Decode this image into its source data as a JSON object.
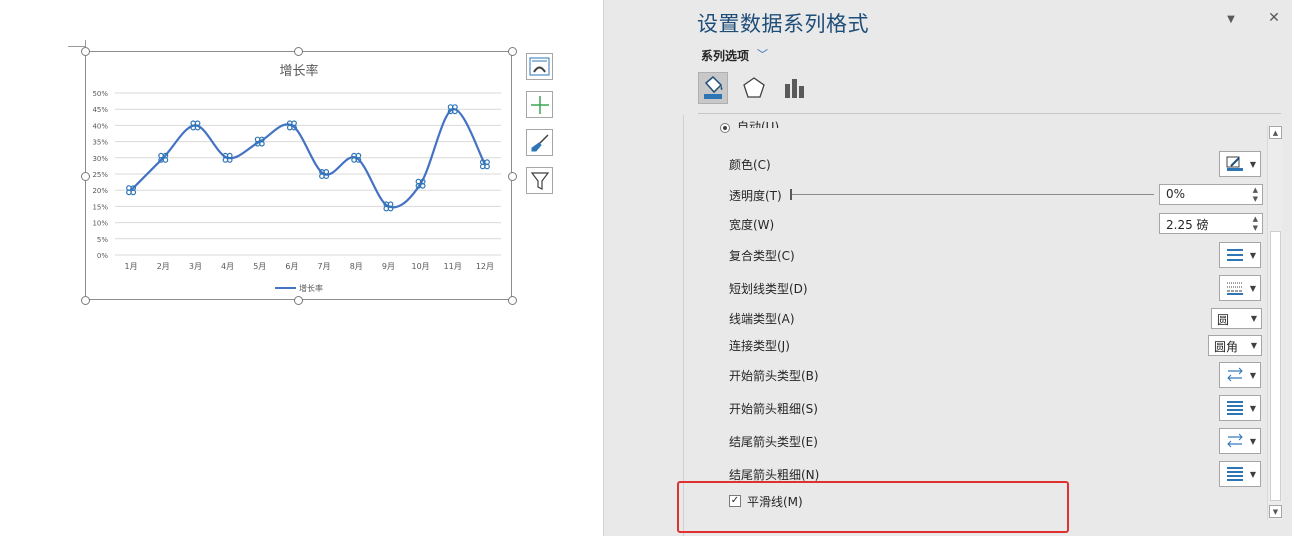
{
  "chart_data": {
    "type": "line",
    "title": "增长率",
    "categories": [
      "1月",
      "2月",
      "3月",
      "4月",
      "5月",
      "6月",
      "7月",
      "8月",
      "9月",
      "10月",
      "11月",
      "12月"
    ],
    "series": [
      {
        "name": "增长率",
        "values": [
          20,
          30,
          40,
          30,
          35,
          40,
          25,
          30,
          15,
          22,
          45,
          28
        ],
        "color": "#4472c4",
        "smooth": true
      }
    ],
    "y_ticks": [
      "0%",
      "5%",
      "10%",
      "15%",
      "20%",
      "25%",
      "30%",
      "35%",
      "40%",
      "45%",
      "50%"
    ],
    "ylim": [
      0,
      50
    ],
    "grid": true,
    "legend": "bottom"
  },
  "side_buttons": [
    "chart-elements-icon",
    "chart-styles-icon",
    "chart-filters-icon"
  ],
  "pane": {
    "title": "设置数据系列格式",
    "series_options_label": "系列选项",
    "tabs": [
      "fill-line-icon",
      "effects-icon",
      "series-options-icon"
    ],
    "auto_label": "自动(U)",
    "rows": {
      "color": "颜色(C)",
      "transparency": "透明度(T)",
      "transparency_value": "0%",
      "width": "宽度(W)",
      "width_value": "2.25 磅",
      "compound": "复合类型(C)",
      "dash": "短划线类型(D)",
      "cap": "线端类型(A)",
      "cap_value": "圆",
      "join": "连接类型(J)",
      "join_value": "圆角",
      "begin_arrow_type": "开始箭头类型(B)",
      "begin_arrow_size": "开始箭头粗细(S)",
      "end_arrow_type": "结尾箭头类型(E)",
      "end_arrow_size": "结尾箭头粗细(N)",
      "smooth": "平滑线(M)",
      "smooth_checked": "✓"
    },
    "accent_color": "#2e75b6",
    "highlight_color": "#e03131"
  }
}
